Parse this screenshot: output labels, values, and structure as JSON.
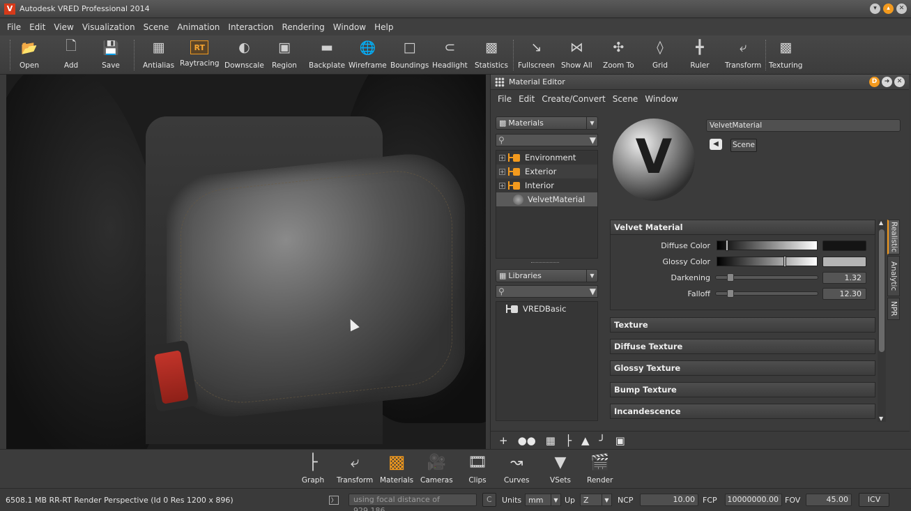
{
  "window": {
    "title": "Autodesk VRED Professional 2014",
    "logo_letter": "V"
  },
  "menubar": [
    "File",
    "Edit",
    "View",
    "Visualization",
    "Scene",
    "Animation",
    "Interaction",
    "Rendering",
    "Window",
    "Help"
  ],
  "toolbar": {
    "open": "Open",
    "add": "Add",
    "save": "Save",
    "antialias": "Antialias",
    "raytracing": "Raytracing",
    "raytracing_icon": "RT",
    "downscale": "Downscale",
    "region": "Region",
    "backplate": "Backplate",
    "wireframe": "Wireframe",
    "boundings": "Boundings",
    "headlight": "Headlight",
    "statistics": "Statistics",
    "fullscreen": "Fullscreen",
    "show_all": "Show All",
    "zoom_to": "Zoom To",
    "grid": "Grid",
    "ruler": "Ruler",
    "transform": "Transform",
    "texturing": "Texturing"
  },
  "material_editor": {
    "title": "Material Editor",
    "menu": [
      "File",
      "Edit",
      "Create/Convert",
      "Scene",
      "Window"
    ],
    "materials_combo": "Materials",
    "libraries_combo": "Libraries",
    "tree": [
      {
        "label": "Environment"
      },
      {
        "label": "Exterior"
      },
      {
        "label": "Interior"
      },
      {
        "label": "VelvetMaterial"
      }
    ],
    "library_tree": [
      {
        "label": "VREDBasic"
      }
    ],
    "material_name": "VelvetMaterial",
    "scene_button": "Scene",
    "section_title": "Velvet Material",
    "diffuse_label": "Diffuse Color",
    "glossy_label": "Glossy Color",
    "darkening_label": "Darkening",
    "darkening_value": "1.32",
    "falloff_label": "Falloff",
    "falloff_value": "12.30",
    "collapsed_sections": [
      "Texture",
      "Diffuse Texture",
      "Glossy Texture",
      "Bump Texture",
      "Incandescence"
    ],
    "side_tabs": [
      "Realistic",
      "Analytic",
      "NPR"
    ],
    "colors": {
      "diffuse": "#141414",
      "glossy": "#b4b4b4",
      "accent": "#f39a1e"
    }
  },
  "dock": [
    "Graph",
    "Transform",
    "Materials",
    "Cameras",
    "Clips",
    "Curves",
    "VSets",
    "Render"
  ],
  "status": {
    "memory": "6508.1 MB",
    "mode": "RR-RT",
    "view_info": "Render Perspective (Id 0 Res 1200 x 896)",
    "focal": "using focal distance of 929.186...",
    "c_button": "C",
    "units_label": "Units",
    "units_value": "mm",
    "up_label": "Up",
    "up_value": "Z",
    "ncp_label": "NCP",
    "ncp_value": "10.00",
    "fcp_label": "FCP",
    "fcp_value": "10000000.00",
    "fov_label": "FOV",
    "fov_value": "45.00",
    "icv_button": "ICV"
  }
}
